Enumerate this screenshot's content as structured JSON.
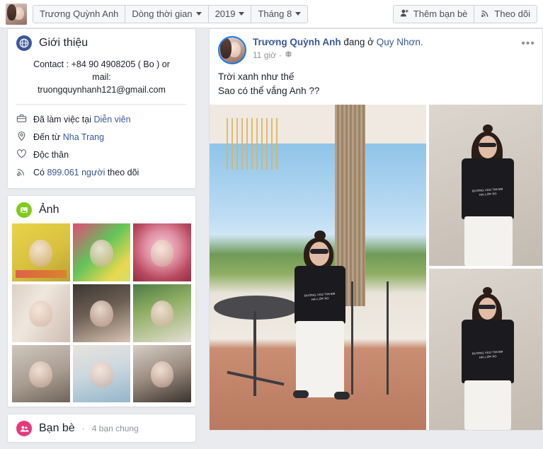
{
  "topbar": {
    "avatar_name": "profile-thumbnail",
    "nav": [
      {
        "label": "Trương Quỳnh Anh",
        "caret": false
      },
      {
        "label": "Dòng thời gian",
        "caret": true
      },
      {
        "label": "2019",
        "caret": true
      },
      {
        "label": "Tháng 8",
        "caret": true
      }
    ],
    "actions": [
      {
        "label": "Thêm bạn bè",
        "icon": "add-friend-icon"
      },
      {
        "label": "Theo dõi",
        "icon": "rss-follow-icon"
      }
    ]
  },
  "sidebar": {
    "intro": {
      "icon": "globe-icon",
      "icon_color": "#3b5998",
      "title": "Giới thiệu",
      "contact_line1": "Contact : +84 90 4908205 ( Bo ) or mail:",
      "contact_line2": "truongquynhanh121@gmail.com",
      "rows": [
        {
          "icon": "briefcase-icon",
          "prefix": "Đã làm việc tại ",
          "link": "Diễn viên",
          "suffix": ""
        },
        {
          "icon": "location-pin-icon",
          "prefix": "Đến từ ",
          "link": "Nha Trang",
          "suffix": ""
        },
        {
          "icon": "heart-icon",
          "prefix": "Độc thân",
          "link": "",
          "suffix": ""
        },
        {
          "icon": "rss-icon",
          "prefix": "Có ",
          "link": "899.061 người",
          "suffix": " theo dõi"
        }
      ]
    },
    "photos": {
      "icon": "photo-icon",
      "icon_color": "#82c91e",
      "title": "Ảnh",
      "items": [
        {
          "name": "photo-1",
          "alt": "group in yellow shirts"
        },
        {
          "name": "photo-2",
          "alt": "stage performance"
        },
        {
          "name": "photo-3",
          "alt": "temple ceremony"
        },
        {
          "name": "photo-4",
          "alt": "wedding collage"
        },
        {
          "name": "photo-5",
          "alt": "portrait indoors"
        },
        {
          "name": "photo-6",
          "alt": "portrait with greenery"
        },
        {
          "name": "photo-7",
          "alt": "reclining portrait"
        },
        {
          "name": "photo-8",
          "alt": "portrait blue dress"
        },
        {
          "name": "photo-9",
          "alt": "portrait dark top"
        }
      ]
    },
    "friends": {
      "icon": "friends-icon",
      "icon_color": "#e6397b",
      "title": "Bạn bè",
      "separator": "·",
      "subtitle": "4 bạn chung"
    }
  },
  "post": {
    "author": "Trương Quỳnh Anh",
    "action": " đang ở ",
    "place": "Quy Nhơn.",
    "time": "11 giờ",
    "meta_separator": "·",
    "privacy_icon": "globe-icon",
    "menu_icon": "more-options-icon",
    "menu_glyph": "•••",
    "text_line1": "Trời xanh như thế",
    "text_line2": "Sao có thể vắng Anh ??",
    "tee_text_line1": "ĐƯỜNG VÀO TIM EM",
    "tee_text_line2": "HAI LỚP ÁO",
    "photos": [
      {
        "name": "post-photo-main",
        "alt": "seated at cafe terrace"
      },
      {
        "name": "post-photo-top-right",
        "alt": "standing portrait"
      },
      {
        "name": "post-photo-bottom-right",
        "alt": "portrait adjusting sunglasses"
      }
    ]
  },
  "colors": {
    "page_bg": "#e9ebee",
    "card_bg": "#ffffff",
    "link": "#385898",
    "muted": "#90949c",
    "border": "#dddfe2"
  }
}
